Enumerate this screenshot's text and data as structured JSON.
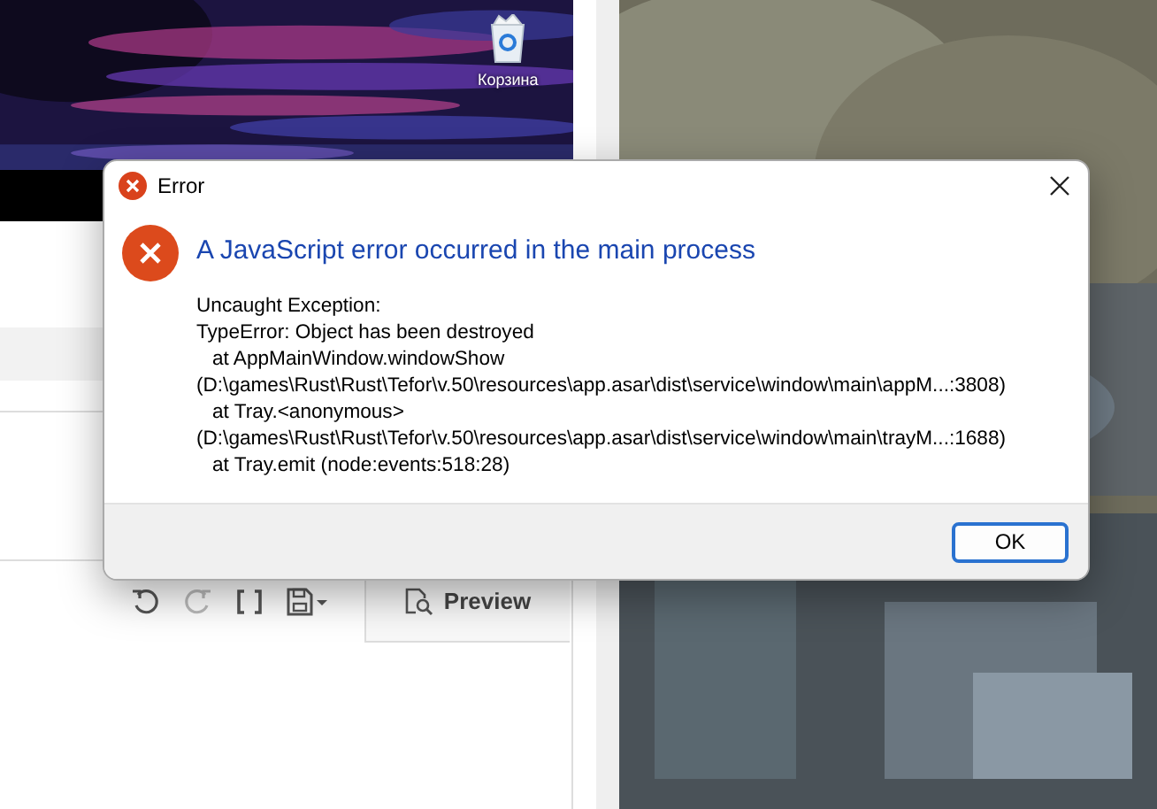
{
  "desktop": {
    "icons": [
      {
        "label": "Корзина"
      }
    ]
  },
  "app": {
    "toolbar": [
      {
        "kind": "undo",
        "disabled": false
      },
      {
        "kind": "redo",
        "disabled": true
      },
      {
        "kind": "brackets",
        "disabled": false
      },
      {
        "kind": "save",
        "disabled": false
      }
    ],
    "preview_button": "Preview"
  },
  "dialog": {
    "title": "Error",
    "heading": "A JavaScript error occurred in the main process",
    "message_lines": [
      {
        "text": "Uncaught Exception:",
        "kind": "text"
      },
      {
        "text": "TypeError: Object has been destroyed",
        "kind": "text"
      },
      {
        "text": "at AppMainWindow.windowShow",
        "kind": "frame"
      },
      {
        "text": "(D:\\games\\Rust\\Rust\\Tefor\\v.50\\resources\\app.asar\\dist\\service\\window\\main\\appM...:3808)",
        "kind": "text"
      },
      {
        "text": "at Tray.<anonymous>",
        "kind": "frame"
      },
      {
        "text": "(D:\\games\\Rust\\Rust\\Tefor\\v.50\\resources\\app.asar\\dist\\service\\window\\main\\trayM...:1688)",
        "kind": "text"
      },
      {
        "text": "at Tray.emit (node:events:518:28)",
        "kind": "frame"
      }
    ],
    "buttons": [
      {
        "label": "OK",
        "selected": true
      }
    ]
  }
}
